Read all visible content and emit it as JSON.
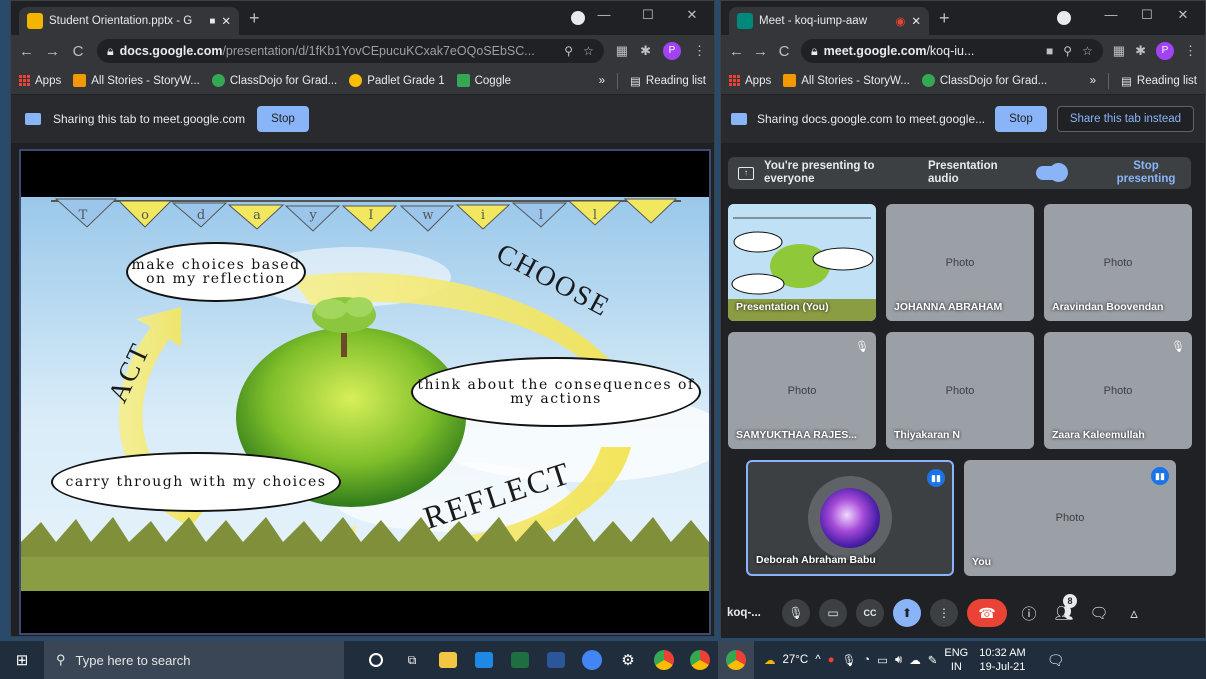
{
  "left_window": {
    "tab_title": "Student Orientation.pptx - G",
    "url_host": "docs.google.com",
    "url_path": "/presentation/d/1fKb1YovCEpucuKCxak7eOQoSEbSC...",
    "bookmarks": [
      "Apps",
      "All Stories - StoryW...",
      "ClassDojo for Grad...",
      "Padlet Grade 1",
      "Coggle"
    ],
    "bookmarks_more": "»",
    "reading_list": "Reading list",
    "infobar_text": "Sharing this tab to meet.google.com",
    "stop_label": "Stop",
    "slide": {
      "banner_letters": [
        "T",
        "o",
        "d",
        "a",
        "y",
        "I",
        "w",
        "i",
        "l",
        "l"
      ],
      "cloud_make": "make choices based on my reflection",
      "cloud_think": "think about the consequences of my actions",
      "cloud_carry": "carry through with my choices",
      "word_choose": "CHOOSE",
      "word_act": "ACT",
      "word_reflect": "REFLECT"
    }
  },
  "right_window": {
    "tab_title": "Meet - koq-iump-aaw",
    "url_host": "meet.google.com",
    "url_path": "/koq-iu...",
    "bookmarks": [
      "Apps",
      "All Stories - StoryW...",
      "ClassDojo for Grad..."
    ],
    "bookmarks_more": "»",
    "reading_list": "Reading list",
    "infobar_text": "Sharing docs.google.com to meet.google...",
    "stop_label": "Stop",
    "share_instead_label": "Share this tab instead",
    "presenting_text": "You're presenting to everyone",
    "presentation_audio_label": "Presentation audio",
    "stop_presenting_label": "Stop presenting",
    "participants": [
      {
        "name": "Presentation (You)"
      },
      {
        "name": "JOHANNA ABRAHAM"
      },
      {
        "name": "Aravindan Boovendan"
      },
      {
        "name": "SAMYUKTHAA RAJES..."
      },
      {
        "name": "Thiyakaran N"
      },
      {
        "name": "Zaara Kaleemullah"
      },
      {
        "name": "Deborah Abraham Babu"
      },
      {
        "name": "You"
      }
    ],
    "meeting_code_short": "koq-...",
    "people_count": "8"
  },
  "taskbar": {
    "search_placeholder": "Type here to search",
    "weather": "27°C",
    "language_line1": "ENG",
    "language_line2": "IN",
    "time": "10:32 AM",
    "date": "19-Jul-21"
  },
  "colors": {
    "chrome_dark": "#202124",
    "accent_blue": "#8ab4f8",
    "hangup_red": "#ea4335",
    "slides_yellow": "#f4b400"
  }
}
